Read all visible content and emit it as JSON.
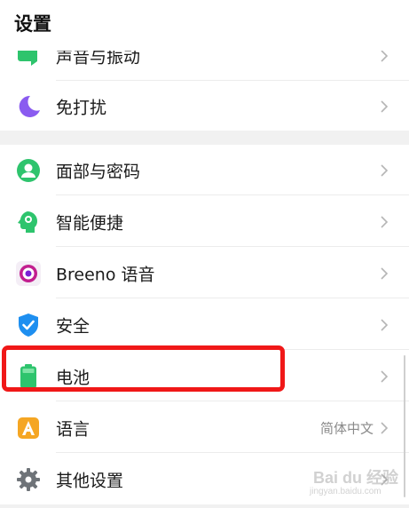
{
  "header": {
    "title": "设置"
  },
  "rows": [
    {
      "label": "声音与振动",
      "icon": "sound-vibration-icon",
      "value": ""
    },
    {
      "label": "免打扰",
      "icon": "moon-icon",
      "value": ""
    },
    {
      "label": "面部与密码",
      "icon": "face-lock-icon",
      "value": ""
    },
    {
      "label": "智能便捷",
      "icon": "smart-head-icon",
      "value": ""
    },
    {
      "label": "Breeno 语音",
      "icon": "breeno-icon",
      "value": ""
    },
    {
      "label": "安全",
      "icon": "shield-icon",
      "value": ""
    },
    {
      "label": "电池",
      "icon": "battery-icon",
      "value": ""
    },
    {
      "label": "语言",
      "icon": "language-icon",
      "value": "简体中文"
    },
    {
      "label": "其他设置",
      "icon": "gear-icon",
      "value": ""
    }
  ],
  "watermark": {
    "brand": "Bai du 经验",
    "url": "jingyan.baidu.com"
  },
  "colors": {
    "highlight": "#f01818",
    "green": "#2ec46d",
    "purple": "#8a5bf0",
    "blue": "#1e8ff0",
    "orange": "#f5a623"
  }
}
